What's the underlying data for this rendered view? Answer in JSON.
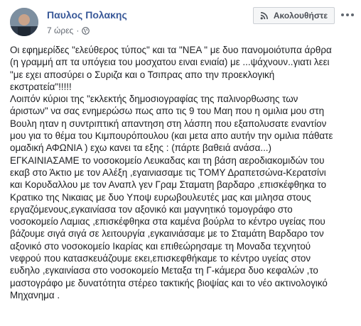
{
  "post": {
    "author": "Παυλος Πολακης",
    "time": "7 ώρες",
    "separator": "·",
    "follow_label": "Ακολουθήστε",
    "lines": [
      "Οι εφημερίδες \"ελεύθερος τύπος\" και τα \"ΝΕΑ \" με δυο πανομοιότυπα άρθρα",
      "(η γραμμή απ τα υπόγεια του μοσχατου ειναι ενιαία) με ...ψάχνουν..γιατι λεει",
      "\"με εχει αποσύρει ο Συριζα και ο Τσιπρας απο την προεκλογική",
      "εκστρατεία\"!!!!!",
      "Λοιπόν κύριοι της \"εκλεκτής δημοσιογραφίας της παλινορθωσης των",
      "άριστων\" να σας ενημερώσω πως απο τις 9 του Μαη που η ομιλια μου στη",
      "Βουλη ηταν η συντριπτική απαντηση στη λάσπη που εξαπολυσατε εναντίον",
      "μου για το θέμα του Κιμπουρόπουλου (και μετα απο αυτήν την ομιλια πάθατε",
      "ομαδική ΑΦΩΝΙΑ ) εχω κανει τα εξης : (πάρτε βαθειά ανάσα...)",
      "ΕΓΚΑΙΝΙΑΣΑΜΕ το νοσοκομείο Λευκαδας και τη βάση αεροδιακομιδών του",
      "εκαβ στο Άκτιο με τον Αλέξη ,εγαινιασαμε τις ΤΟΜΥ Δραπετσώνα-Κερατσίνι",
      "και Κορυδαλλου με τον Αναπλ γεν Γραμ Σταματη βαρδαρο ,επισκέφθηκα το",
      "Κρατικο της Νικαιας με δυο Υποψ ευρωβουλευτές μας και μιλησα στους",
      "εργαζόμενους,εγκαινίασα τον αξονικό και μαγνητικό τομογράφο στο",
      "νοσοκομείο Λαμιας ,επισκέφθηκα στα καμένα βούρλα το κέντρο υγείας που",
      "βάζουμε σιγά σιγά σε λειτουργία ,εγκαινιάσαμε με το Σταμάτη Βαρδαρο τον",
      "αξονικό στο νοσοκομείο Ικαρίας και επιθεώρησαμε τη Μοναδα τεχνητού",
      "νεφρού που κατασκευάζουμε εκει,επισκεφθήκαμε το κέντρο υγείας στον",
      "ευδηλο ,εγκαινίασα στο νοσοκομείο Μεταξα τη Γ-κάμερα δυο κεφαλών ,το",
      "μαστογράφο με δυνατότητα στέρεο τακτικής βιοψίας και το νέο ακτινολογικό",
      "Μηχανημα ."
    ]
  }
}
